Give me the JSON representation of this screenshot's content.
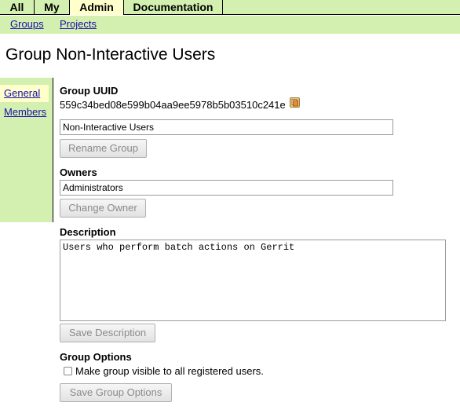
{
  "top_menu": {
    "tabs": [
      {
        "label": "All"
      },
      {
        "label": "My"
      },
      {
        "label": "Admin"
      },
      {
        "label": "Documentation"
      }
    ]
  },
  "sub_menu": {
    "links": [
      {
        "label": "Groups"
      },
      {
        "label": "Projects"
      }
    ]
  },
  "page": {
    "title": "Group Non-Interactive Users"
  },
  "side_nav": {
    "items": [
      {
        "label": "General"
      },
      {
        "label": "Members"
      }
    ]
  },
  "group_uuid": {
    "label": "Group UUID",
    "value": "559c34bed08e599b04aa9ee5978b5b03510c241e",
    "copy_icon": "copy-icon"
  },
  "group_name": {
    "value": "Non-Interactive Users",
    "button": "Rename Group"
  },
  "owners": {
    "label": "Owners",
    "value": "Administrators",
    "button": "Change Owner"
  },
  "description": {
    "label": "Description",
    "value": "Users who perform batch actions on Gerrit",
    "button": "Save Description"
  },
  "group_options": {
    "label": "Group Options",
    "checkbox_label": "Make group visible to all registered users.",
    "checked": false,
    "button": "Save Group Options"
  },
  "colors": {
    "menu_bg": "#d4f0b0",
    "active_tab_bg": "#ffffcc",
    "link": "#1a0dab"
  }
}
